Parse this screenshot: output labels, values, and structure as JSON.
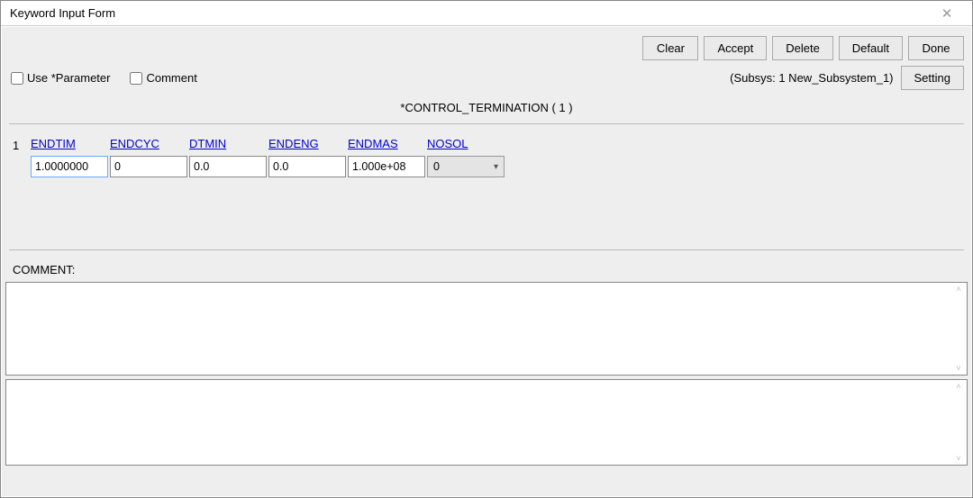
{
  "window": {
    "title": "Keyword Input Form",
    "close_icon": "✕"
  },
  "toolbar": {
    "clear": "Clear",
    "accept": "Accept",
    "delete": "Delete",
    "default": "Default",
    "done": "Done"
  },
  "options": {
    "use_parameter": "Use *Parameter",
    "comment": "Comment",
    "subsys": "(Subsys: 1 New_Subsystem_1)",
    "setting": "Setting"
  },
  "keyword": {
    "title": "*CONTROL_TERMINATION    ( 1 )"
  },
  "params": {
    "row": "1",
    "labels": {
      "endtim": "ENDTIM",
      "endcyc": "ENDCYC",
      "dtmin": "DTMIN",
      "endeng": "ENDENG",
      "endmas": "ENDMAS",
      "nosol": "NOSOL"
    },
    "values": {
      "endtim": "1.0000000",
      "endcyc": "0",
      "dtmin": "0.0",
      "endeng": "0.0",
      "endmas": "1.000e+08",
      "nosol": "0"
    }
  },
  "comment": {
    "label": "COMMENT:",
    "value1": "",
    "value2": ""
  }
}
